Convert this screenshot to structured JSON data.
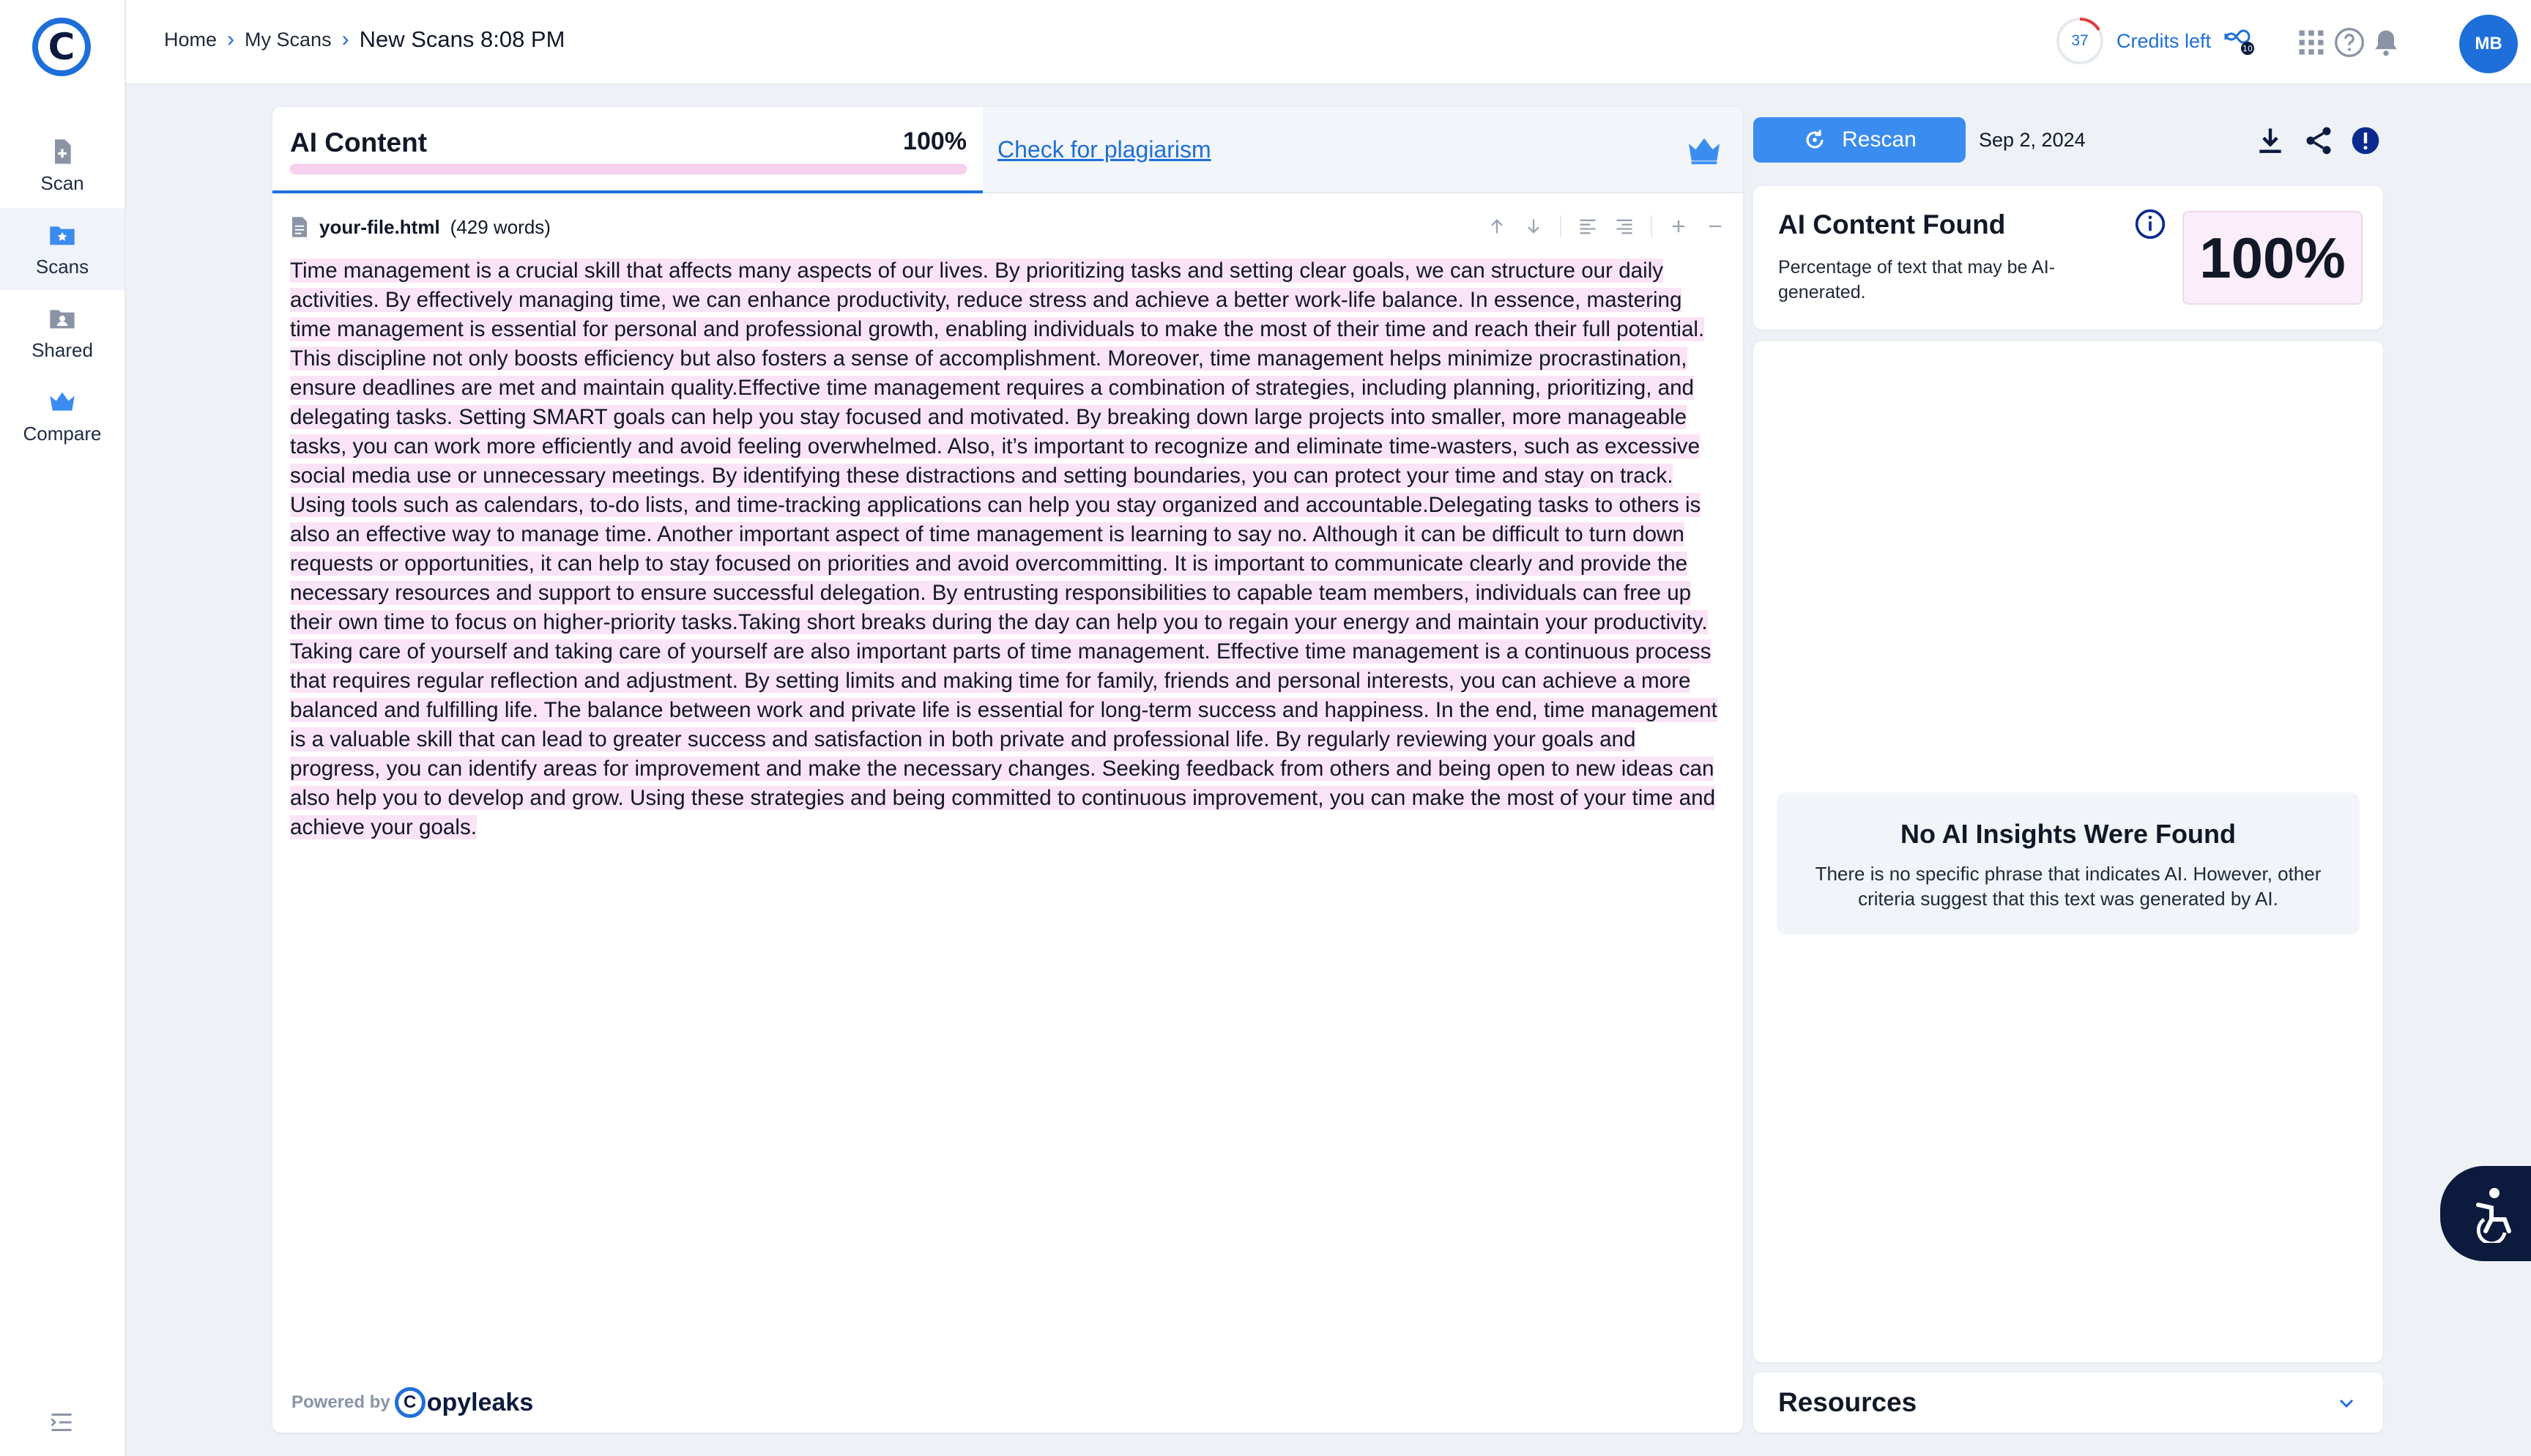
{
  "sidebar": {
    "logo_letter": "C",
    "items": [
      {
        "label": "Scan",
        "icon": "file-plus-icon"
      },
      {
        "label": "Scans",
        "icon": "folder-star-icon"
      },
      {
        "label": "Shared",
        "icon": "folder-user-icon"
      },
      {
        "label": "Compare",
        "icon": "crown-icon"
      }
    ],
    "active_index": 1
  },
  "breadcrumb": {
    "home": "Home",
    "my_scans": "My Scans",
    "current": "New Scans 8:08 PM"
  },
  "header": {
    "credits_count": "37",
    "credits_label": "Credits left",
    "loop_badge": "10",
    "avatar_initials": "MB"
  },
  "tabs": {
    "ai_label": "AI Content",
    "ai_percent": "100%",
    "ai_percent_value": 100,
    "plagiarism_label": "Check for plagiarism"
  },
  "file": {
    "name": "your-file.html",
    "words": "(429 words)"
  },
  "content": {
    "text": "Time management is a crucial skill that affects many aspects of our lives. By prioritizing tasks and setting clear goals, we can structure our daily activities. By effectively managing time, we can enhance productivity, reduce stress and achieve a better work-life balance. In essence, mastering time management is essential for personal and professional growth, enabling individuals to make the most of their time and reach their full potential. This discipline not only boosts efficiency but also fosters a sense of accomplishment. Moreover, time management helps minimize procrastination, ensure deadlines are met and maintain quality.Effective time management requires a combination of strategies, including planning, prioritizing, and delegating tasks. Setting SMART goals can help you stay focused and motivated. By breaking down large projects into smaller, more manageable tasks, you can work more efficiently and avoid feeling overwhelmed. Also, it’s important to recognize and eliminate time-wasters, such as excessive social media use or unnecessary meetings. By identifying these distractions and setting boundaries, you can protect your time and stay on track. Using tools such as calendars, to-do lists, and time-tracking applications can help you stay organized and accountable.Delegating tasks to others is also an effective way to manage time. Another important aspect of time management is learning to say no. Although it can be difficult to turn down requests or opportunities, it can help to stay focused on priorities and avoid overcommitting. It is important to communicate clearly and provide the necessary resources and support to ensure successful delegation. By entrusting responsibilities to capable team members, individuals can free up their own time to focus on higher-priority tasks.Taking short breaks during the day can help you to regain your energy and maintain your productivity. Taking care of yourself and taking care of yourself are also important parts of time management. Effective time management is a continuous process that requires regular reflection and adjustment. By setting limits and making time for family, friends and personal interests, you can achieve a more balanced and fulfilling life. The balance between work and private life is essential for long-term success and happiness. In the end, time management is a valuable skill that can lead to greater success and satisfaction in both private and professional life. By regularly reviewing your goals and progress, you can identify areas for improvement and make the necessary changes. Seeking feedback from others and being open to new ideas can also help you to develop and grow. Using these strategies and being committed to continuous improvement, you can make the most of your time and achieve your goals."
  },
  "footer": {
    "powered_by": "Powered by",
    "brand": "opyleaks",
    "brand_mark": "C"
  },
  "results": {
    "rescan_label": "Rescan",
    "date": "Sep 2, 2024",
    "found_title": "AI Content Found",
    "found_desc": "Percentage of text that may be AI-generated.",
    "found_percent": "100%",
    "insights_title": "No AI Insights Were Found",
    "insights_desc": "There is no specific phrase that indicates AI. However, other criteria suggest that this text was generated by AI.",
    "resources_label": "Resources"
  },
  "colors": {
    "accent": "#1e6fd9",
    "highlight": "#fbe3f6",
    "navy": "#0b1a3d"
  }
}
